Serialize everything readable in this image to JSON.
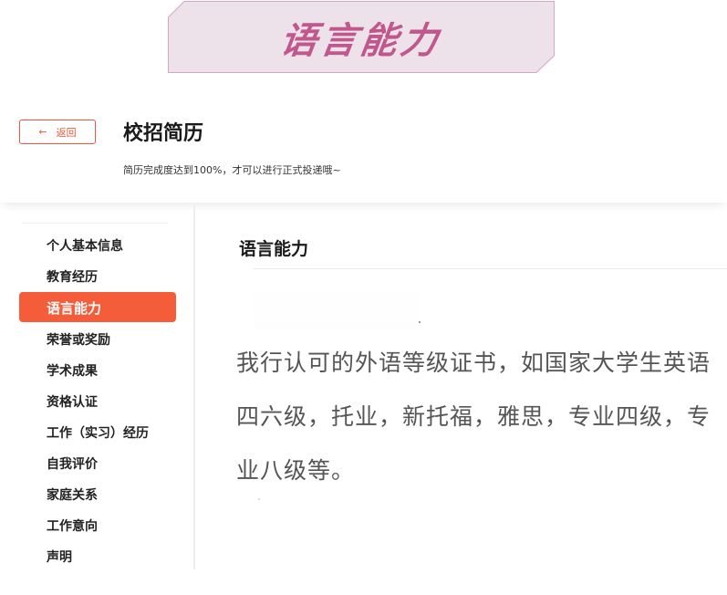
{
  "banner": {
    "title": "语言能力"
  },
  "header": {
    "back_label": "返回",
    "title": "校招简历",
    "subtitle": "简历完成度达到100%，才可以进行正式投递哦~"
  },
  "sidebar": {
    "items": [
      {
        "label": "个人基本信息",
        "active": false
      },
      {
        "label": "教育经历",
        "active": false
      },
      {
        "label": "语言能力",
        "active": true
      },
      {
        "label": "荣誉或奖励",
        "active": false
      },
      {
        "label": "学术成果",
        "active": false
      },
      {
        "label": "资格认证",
        "active": false
      },
      {
        "label": "工作（实习）经历",
        "active": false
      },
      {
        "label": "自我评价",
        "active": false
      },
      {
        "label": "家庭关系",
        "active": false
      },
      {
        "label": "工作意向",
        "active": false
      },
      {
        "label": "声明",
        "active": false
      }
    ]
  },
  "main": {
    "section_title": "语言能力",
    "description": "我行认可的外语等级证书，如国家大学生英语四六级，托业，新托福，雅思，专业四级，专业八级等。"
  },
  "colors": {
    "accent": "#f45c3a",
    "banner_bg": "#ede1ea",
    "banner_text": "#c0578d"
  }
}
